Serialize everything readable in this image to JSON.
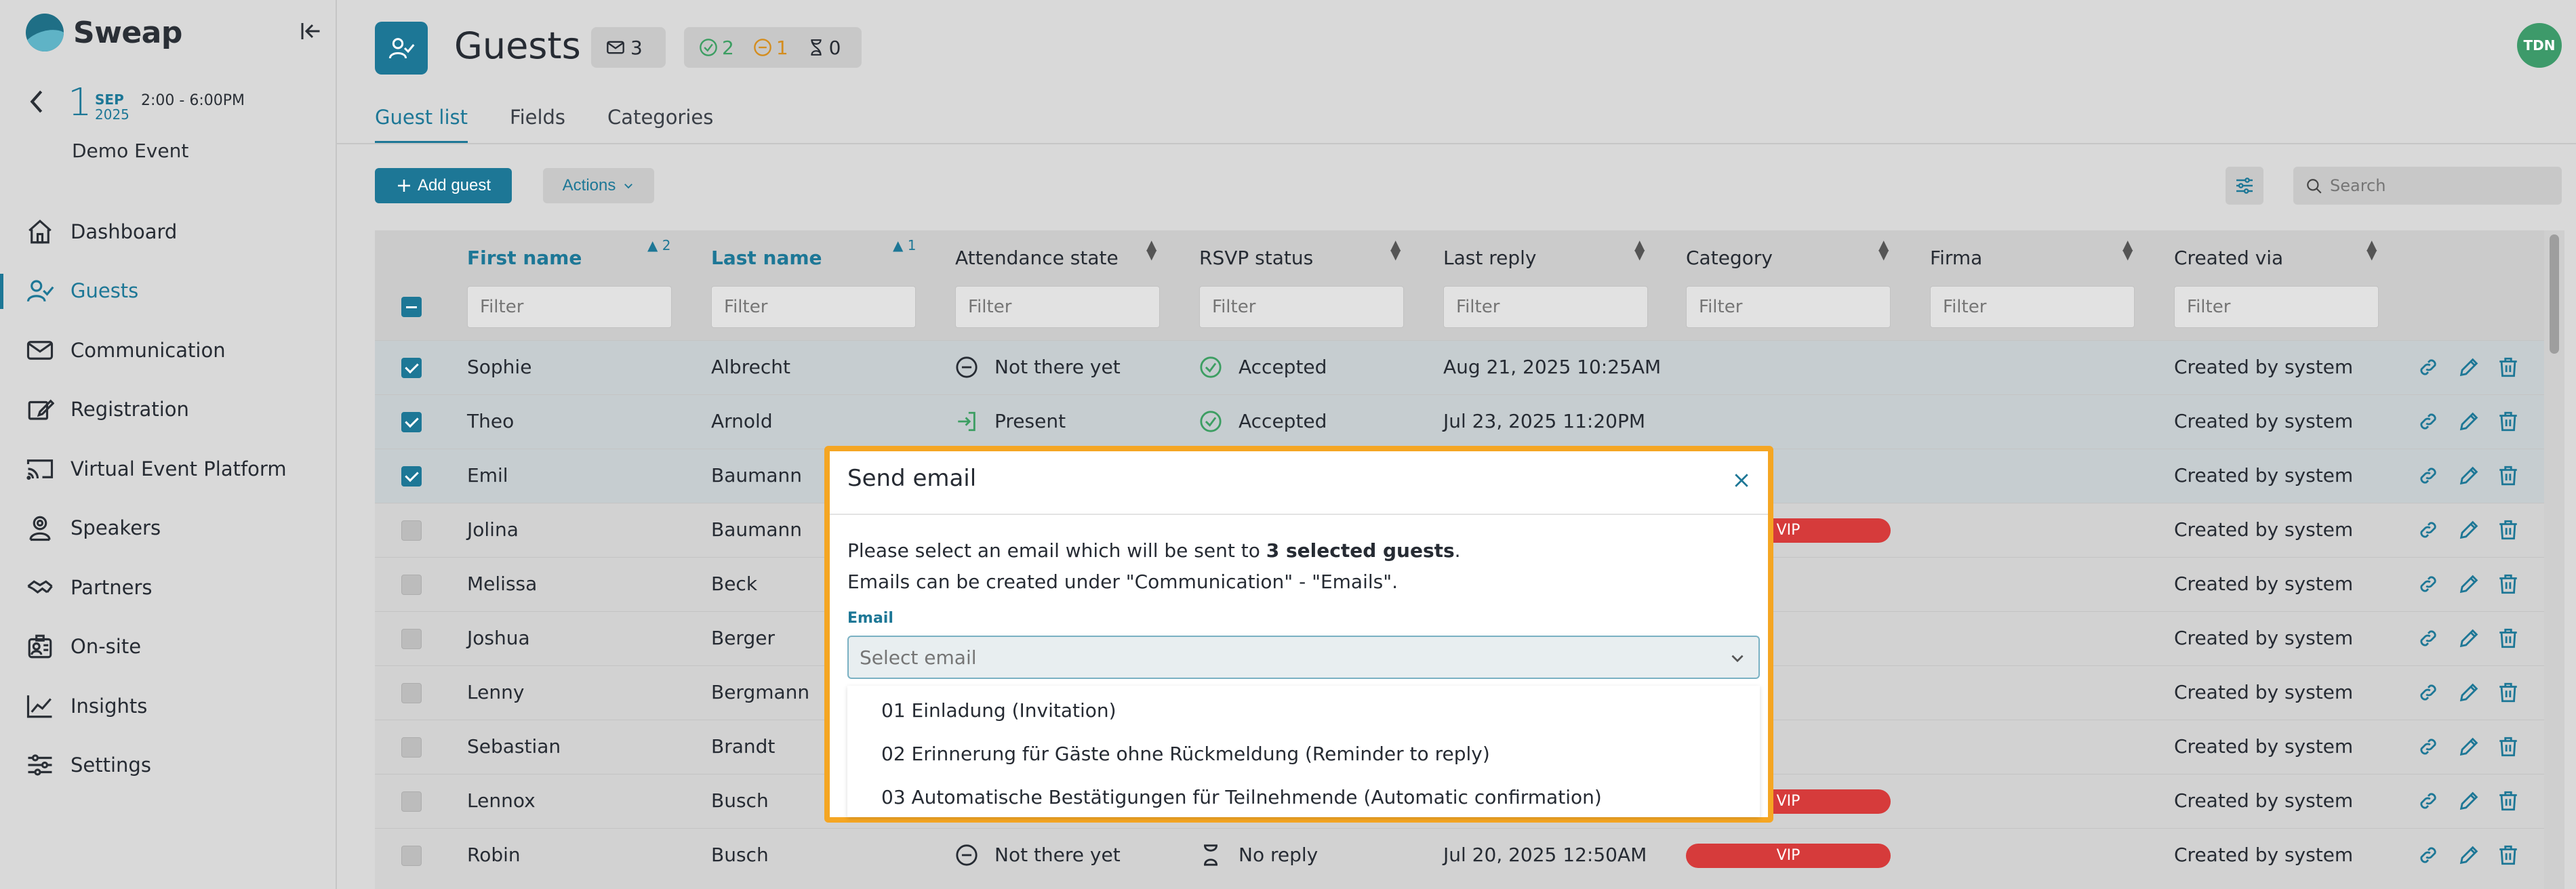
{
  "app": {
    "name": "Sweap"
  },
  "event": {
    "day": "1",
    "month": "SEP",
    "year": "2025",
    "time": "2:00 - 6:00PM",
    "name": "Demo Event"
  },
  "nav": [
    {
      "label": "Dashboard",
      "icon": "home-icon"
    },
    {
      "label": "Guests",
      "icon": "user-check-icon",
      "active": true
    },
    {
      "label": "Communication",
      "icon": "mail-icon"
    },
    {
      "label": "Registration",
      "icon": "registration-icon"
    },
    {
      "label": "Virtual Event Platform",
      "icon": "cast-icon"
    },
    {
      "label": "Speakers",
      "icon": "speaker-icon"
    },
    {
      "label": "Partners",
      "icon": "handshake-icon"
    },
    {
      "label": "On-site",
      "icon": "badge-icon"
    },
    {
      "label": "Insights",
      "icon": "chart-icon"
    },
    {
      "label": "Settings",
      "icon": "sliders-icon"
    }
  ],
  "header": {
    "title": "Guests",
    "mail_count": "3",
    "accepted_count": "2",
    "declined_count": "1",
    "pending_count": "0",
    "avatar": "TDN"
  },
  "tabs": [
    "Guest list",
    "Fields",
    "Categories"
  ],
  "toolbar": {
    "add_guest": "Add guest",
    "actions": "Actions",
    "search_placeholder": "Search"
  },
  "table": {
    "columns": [
      "First name",
      "Last name",
      "Attendance state",
      "RSVP status",
      "Last reply",
      "Category",
      "Firma",
      "Created via"
    ],
    "sort_first": "2",
    "sort_last": "1",
    "filter_placeholder": "Filter",
    "rows": [
      {
        "first": "Sophie",
        "last": "Albrecht",
        "attendance": "Not there yet",
        "rsvp": "Accepted",
        "reply": "Aug 21, 2025 10:25AM",
        "category": "",
        "created": "Created by system",
        "selected": true
      },
      {
        "first": "Theo",
        "last": "Arnold",
        "attendance": "Present",
        "rsvp": "Accepted",
        "reply": "Jul 23, 2025 11:20PM",
        "category": "",
        "created": "Created by system",
        "selected": true
      },
      {
        "first": "Emil",
        "last": "Baumann",
        "attendance": "",
        "rsvp": "",
        "reply": "",
        "category": "",
        "created": "Created by system",
        "selected": true
      },
      {
        "first": "Jolina",
        "last": "Baumann",
        "attendance": "",
        "rsvp": "",
        "reply": "",
        "category": "VIP",
        "created": "Created by system",
        "selected": false
      },
      {
        "first": "Melissa",
        "last": "Beck",
        "attendance": "",
        "rsvp": "",
        "reply": "",
        "category": "",
        "created": "Created by system",
        "selected": false
      },
      {
        "first": "Joshua",
        "last": "Berger",
        "attendance": "",
        "rsvp": "",
        "reply": "",
        "category": "",
        "created": "Created by system",
        "selected": false
      },
      {
        "first": "Lenny",
        "last": "Bergmann",
        "attendance": "",
        "rsvp": "",
        "reply": "",
        "category": "",
        "created": "Created by system",
        "selected": false
      },
      {
        "first": "Sebastian",
        "last": "Brandt",
        "attendance": "",
        "rsvp": "",
        "reply": "",
        "category": "",
        "created": "Created by system",
        "selected": false
      },
      {
        "first": "Lennox",
        "last": "Busch",
        "attendance": "",
        "rsvp": "",
        "reply": "",
        "category": "VIP",
        "created": "Created by system",
        "selected": false
      },
      {
        "first": "Robin",
        "last": "Busch",
        "attendance": "Not there yet",
        "rsvp": "No reply",
        "reply": "Jul 20, 2025 12:50AM",
        "category": "VIP",
        "created": "Created by system",
        "selected": false
      }
    ]
  },
  "modal": {
    "title": "Send email",
    "text_prefix": "Please select an email which will be sent to ",
    "text_bold": "3 selected guests",
    "text_suffix": ".",
    "text_line2": "Emails can be created under \"Communication\" - \"Emails\".",
    "email_label": "Email",
    "select_placeholder": "Select email",
    "options": [
      "01 Einladung (Invitation)",
      "02 Erinnerung für Gäste ohne Rückmeldung (Reminder to reply)",
      "03 Automatische Bestätigungen für Teilnehmende (Automatic confirmation)"
    ]
  },
  "colors": {
    "accent": "#1d7796",
    "vip": "#d63b3b",
    "modal_border": "#f5a623",
    "success": "#3c9e62",
    "warning": "#d48d1e"
  }
}
